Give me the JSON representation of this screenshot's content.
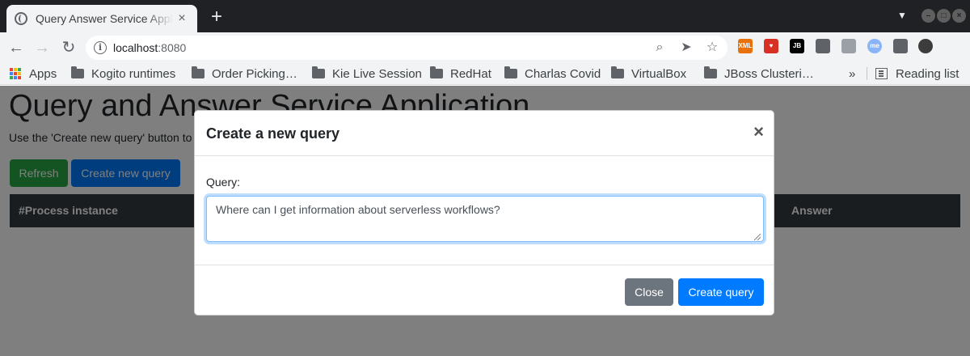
{
  "browser": {
    "tab_title": "Query Answer Service Application",
    "tab_close": "×",
    "new_tab": "+",
    "url_host": "localhost",
    "url_port": ":8080",
    "bookmarks": [
      {
        "label": "Apps",
        "icon": "apps-grid-icon"
      },
      {
        "label": "Kogito runtimes",
        "icon": "folder-icon"
      },
      {
        "label": "Order Picking…",
        "icon": "folder-icon"
      },
      {
        "label": "Kie Live Session",
        "icon": "folder-icon"
      },
      {
        "label": "RedHat",
        "icon": "folder-icon"
      },
      {
        "label": "Charlas Covid",
        "icon": "folder-icon"
      },
      {
        "label": "VirtualBox",
        "icon": "folder-icon"
      },
      {
        "label": "JBoss Clusteri…",
        "icon": "folder-icon"
      }
    ],
    "overflow": "»",
    "reading_list": "Reading list",
    "extensions": [
      {
        "name": "xml-extension-icon",
        "color": "#e8710a",
        "text": "XML"
      },
      {
        "name": "pocket-extension-icon",
        "color": "#d93025",
        "text": "♥"
      },
      {
        "name": "jetbrains-extension-icon",
        "color": "#000000",
        "text": "JB"
      },
      {
        "name": "screenshot-extension-icon",
        "color": "#5f6368",
        "text": ""
      },
      {
        "name": "bi-extension-icon",
        "color": "#9aa0a6",
        "text": ""
      },
      {
        "name": "me-extension-icon",
        "color": "#8ab4f8",
        "text": "me"
      },
      {
        "name": "extensions-puzzle-icon",
        "color": "#5f6368",
        "text": ""
      },
      {
        "name": "profile-avatar",
        "color": "#3c3c3c",
        "text": ""
      }
    ]
  },
  "page": {
    "title": "Query and Answer Service Application",
    "description": "Use the 'Create new query' button to",
    "refresh_label": "Refresh",
    "create_new_label": "Create new query",
    "table_headers": [
      "#Process instance",
      "Answer"
    ]
  },
  "modal": {
    "title": "Create a new query",
    "close_x": "×",
    "field_label": "Query:",
    "query_value": "Where can I get information about serverless workflows?",
    "close_label": "Close",
    "create_label": "Create query"
  },
  "colors": {
    "primary": "#007bff",
    "success": "#28a745",
    "secondary": "#6c757d",
    "table_header": "#343a40"
  }
}
